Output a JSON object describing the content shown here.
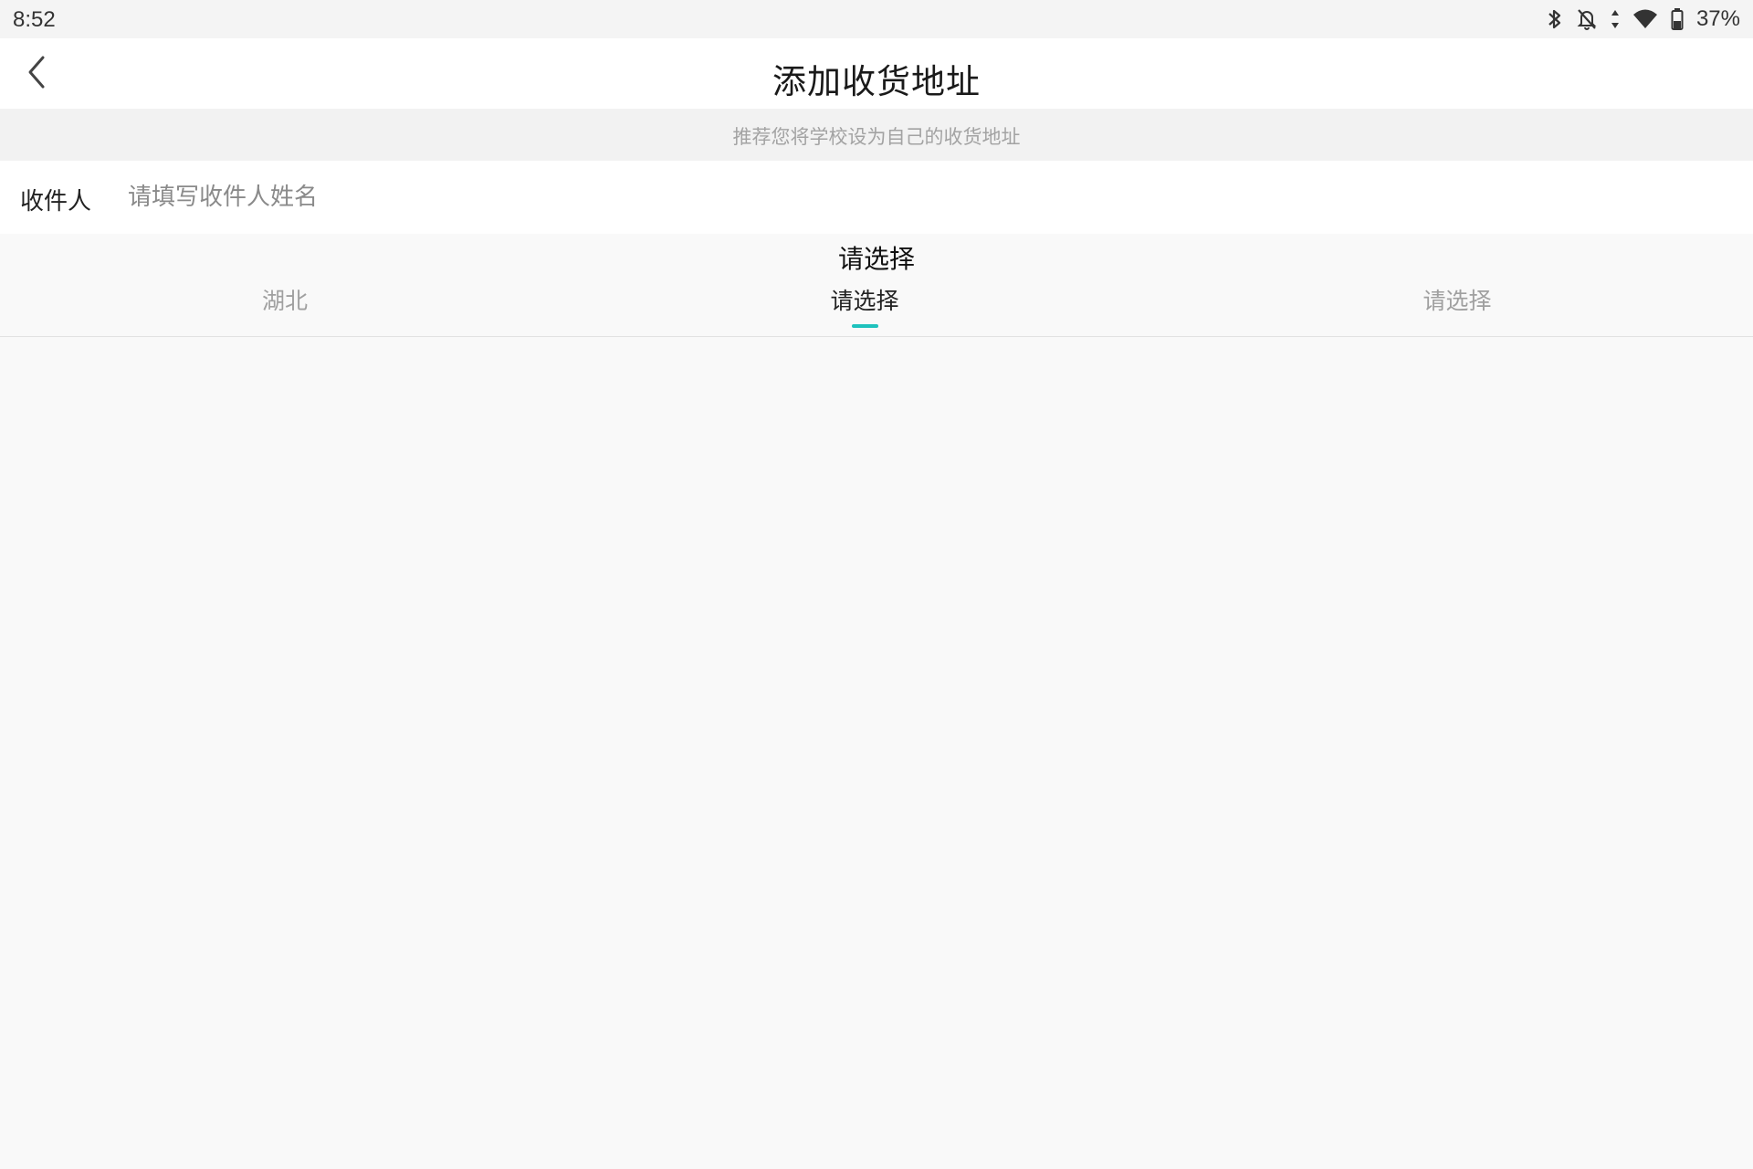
{
  "status_bar": {
    "time": "8:52",
    "battery_percent": "37%",
    "icons": [
      "bluetooth-icon",
      "notifications-off-icon",
      "data-arrows-icon",
      "wifi-icon",
      "battery-icon"
    ]
  },
  "nav": {
    "title": "添加收货地址",
    "back_icon": "chevron-left-icon"
  },
  "hint": {
    "text": "推荐您将学校设为自己的收货地址"
  },
  "recipient": {
    "label": "收件人",
    "value": "",
    "placeholder": "请填写收件人姓名"
  },
  "picker": {
    "title": "请选择",
    "tabs": [
      {
        "label": "湖北",
        "active": false
      },
      {
        "label": "请选择",
        "active": true
      },
      {
        "label": "请选择",
        "active": false
      }
    ],
    "accent_color": "#1ec2bd"
  }
}
